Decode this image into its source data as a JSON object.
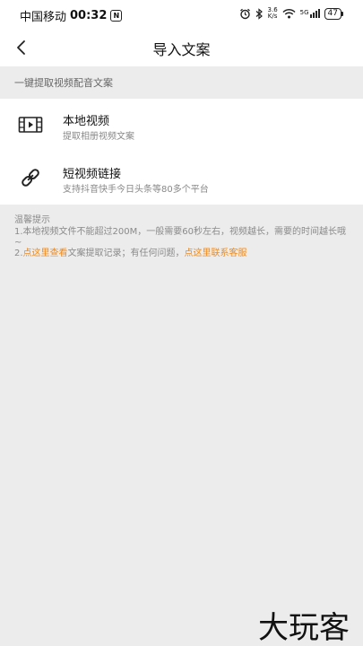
{
  "status_bar": {
    "carrier": "中国移动",
    "time": "00:32",
    "nfc_glyph": "N",
    "speed_value": "3.6",
    "speed_unit": "K/s",
    "signal_label": "5G",
    "battery": "47"
  },
  "nav": {
    "title": "导入文案",
    "back_icon": "chevron-left-icon"
  },
  "section": {
    "header": "一键提取视频配音文案"
  },
  "options": [
    {
      "icon": "video-film-icon",
      "title": "本地视频",
      "subtitle": "提取相册视频文案"
    },
    {
      "icon": "link-icon",
      "title": "短视频链接",
      "subtitle": "支持抖音快手今日头条等80多个平台"
    }
  ],
  "tips": {
    "title": "温馨提示",
    "line1": "1.本地视频文件不能超过200M，一般需要60秒左右，视频越长，需要的时间越长哦~",
    "line2_prefix": "2.",
    "line2_link1": "点这里查看",
    "line2_middle": "文案提取记录；有任何问题，",
    "line2_link2": "点这里联系客服"
  },
  "colors": {
    "accent": "#f08a1c",
    "background": "#ececec",
    "surface": "#ffffff"
  },
  "watermark": {
    "text": "大玩客"
  }
}
